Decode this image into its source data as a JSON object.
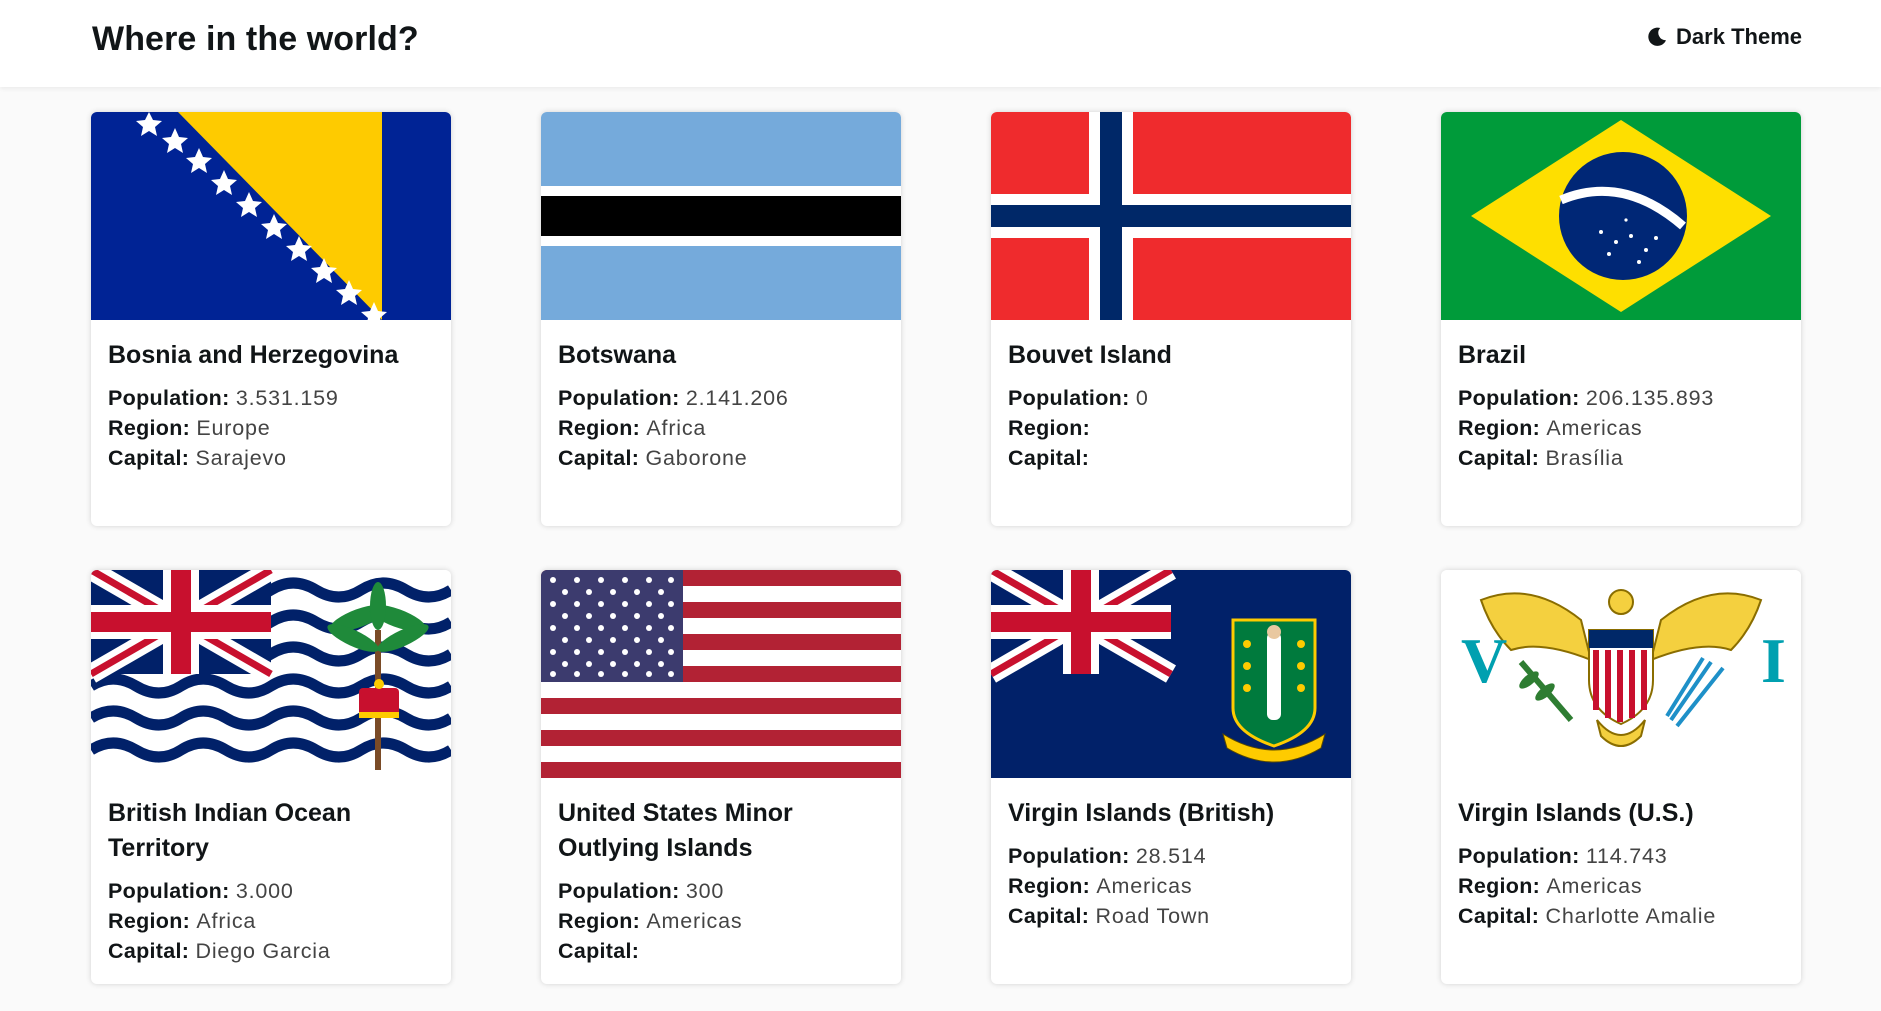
{
  "header": {
    "title": "Where in the world?",
    "theme_toggle_label": "Dark Theme",
    "theme_icon": "moon-icon"
  },
  "labels": {
    "population": "Population:",
    "region": "Region:",
    "capital": "Capital:"
  },
  "countries": [
    {
      "name": "Bosnia and Herzegovina",
      "population": "3.531.159",
      "region": "Europe",
      "capital": "Sarajevo",
      "flag_icon": "flag-bosnia-herzegovina"
    },
    {
      "name": "Botswana",
      "population": "2.141.206",
      "region": "Africa",
      "capital": "Gaborone",
      "flag_icon": "flag-botswana"
    },
    {
      "name": "Bouvet Island",
      "population": "0",
      "region": "",
      "capital": "",
      "flag_icon": "flag-bouvet-island"
    },
    {
      "name": "Brazil",
      "population": "206.135.893",
      "region": "Americas",
      "capital": "Brasília",
      "flag_icon": "flag-brazil"
    },
    {
      "name": "British Indian Ocean Territory",
      "population": "3.000",
      "region": "Africa",
      "capital": "Diego Garcia",
      "flag_icon": "flag-british-indian-ocean-territory"
    },
    {
      "name": "United States Minor Outlying Islands",
      "population": "300",
      "region": "Americas",
      "capital": "",
      "flag_icon": "flag-us-minor-outlying-islands"
    },
    {
      "name": "Virgin Islands (British)",
      "population": "28.514",
      "region": "Americas",
      "capital": "Road Town",
      "flag_icon": "flag-british-virgin-islands"
    },
    {
      "name": "Virgin Islands (U.S.)",
      "population": "114.743",
      "region": "Americas",
      "capital": "Charlotte Amalie",
      "flag_icon": "flag-us-virgin-islands"
    }
  ],
  "colors": {
    "background": "#fafafa",
    "card": "#ffffff",
    "text": "#111517"
  }
}
